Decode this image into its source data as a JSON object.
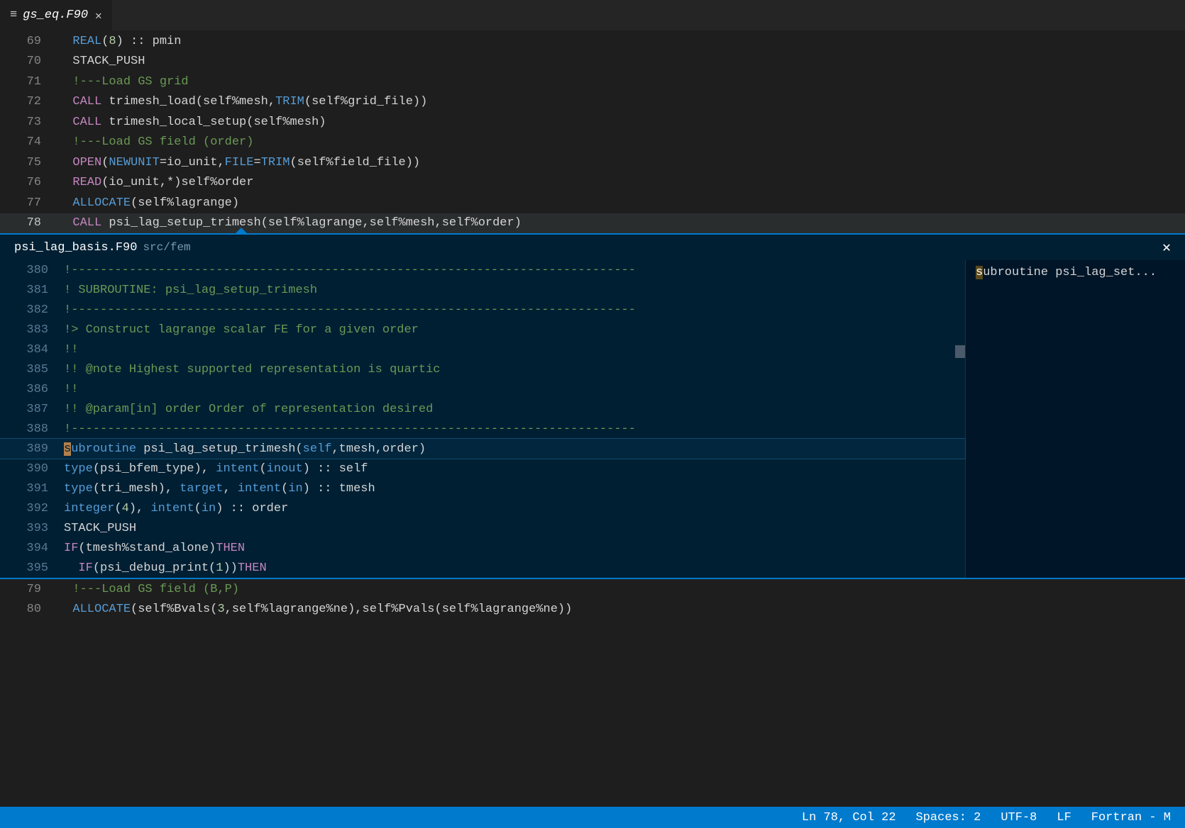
{
  "tab": {
    "filename": "gs_eq.F90",
    "close_glyph": "✕",
    "menu_glyph": "≡"
  },
  "main_lines": [
    {
      "n": 69,
      "segments": [
        {
          "t": "  ",
          "c": "c-id"
        },
        {
          "t": "REAL",
          "c": "c-kw"
        },
        {
          "t": "(",
          "c": "c-op"
        },
        {
          "t": "8",
          "c": "c-num"
        },
        {
          "t": ") :: pmin",
          "c": "c-id"
        }
      ]
    },
    {
      "n": 70,
      "segments": [
        {
          "t": "  STACK_PUSH",
          "c": "c-id"
        }
      ]
    },
    {
      "n": 71,
      "segments": [
        {
          "t": "  !---Load GS grid",
          "c": "c-cmt"
        }
      ]
    },
    {
      "n": 72,
      "segments": [
        {
          "t": "  ",
          "c": "c-id"
        },
        {
          "t": "CALL",
          "c": "c-call"
        },
        {
          "t": " trimesh_load(self%mesh,",
          "c": "c-id"
        },
        {
          "t": "TRIM",
          "c": "c-kw"
        },
        {
          "t": "(self%grid_file))",
          "c": "c-id"
        }
      ]
    },
    {
      "n": 73,
      "segments": [
        {
          "t": "  ",
          "c": "c-id"
        },
        {
          "t": "CALL",
          "c": "c-call"
        },
        {
          "t": " trimesh_local_setup(self%mesh)",
          "c": "c-id"
        }
      ]
    },
    {
      "n": 74,
      "segments": [
        {
          "t": "  !---Load GS field (order)",
          "c": "c-cmt"
        }
      ]
    },
    {
      "n": 75,
      "segments": [
        {
          "t": "  ",
          "c": "c-id"
        },
        {
          "t": "OPEN",
          "c": "c-call"
        },
        {
          "t": "(",
          "c": "c-id"
        },
        {
          "t": "NEWUNIT",
          "c": "c-kw"
        },
        {
          "t": "=io_unit,",
          "c": "c-id"
        },
        {
          "t": "FILE",
          "c": "c-kw"
        },
        {
          "t": "=",
          "c": "c-id"
        },
        {
          "t": "TRIM",
          "c": "c-kw"
        },
        {
          "t": "(self%field_file))",
          "c": "c-id"
        }
      ]
    },
    {
      "n": 76,
      "segments": [
        {
          "t": "  ",
          "c": "c-id"
        },
        {
          "t": "READ",
          "c": "c-call"
        },
        {
          "t": "(io_unit,*)self%order",
          "c": "c-id"
        }
      ]
    },
    {
      "n": 77,
      "segments": [
        {
          "t": "  ",
          "c": "c-id"
        },
        {
          "t": "ALLOCATE",
          "c": "c-kw"
        },
        {
          "t": "(self%lagrange)",
          "c": "c-id"
        }
      ]
    },
    {
      "n": 78,
      "hl": true,
      "segments": [
        {
          "t": "  ",
          "c": "c-id"
        },
        {
          "t": "CALL",
          "c": "c-call"
        },
        {
          "t": " psi_lag_setup_trimesh(self%lagrange,self%mesh,self%order)",
          "c": "c-id"
        }
      ]
    }
  ],
  "main_lines_after": [
    {
      "n": 79,
      "segments": [
        {
          "t": "  !---Load GS field (B,P)",
          "c": "c-cmt"
        }
      ]
    },
    {
      "n": 80,
      "segments": [
        {
          "t": "  ",
          "c": "c-id"
        },
        {
          "t": "ALLOCATE",
          "c": "c-kw"
        },
        {
          "t": "(self%Bvals(",
          "c": "c-id"
        },
        {
          "t": "3",
          "c": "c-num"
        },
        {
          "t": ",self%lagrange%ne),self%Pvals(self%lagrange%ne))",
          "c": "c-id"
        }
      ]
    }
  ],
  "peek": {
    "filename": "psi_lag_basis.F90",
    "path": "src/fem",
    "close_glyph": "✕",
    "sidebar_item_prefix": "s",
    "sidebar_item_rest": "ubroutine psi_lag_set...",
    "lines": [
      {
        "n": 380,
        "segments": [
          {
            "t": "!------------------------------------------------------------------------------",
            "c": "c-cmt"
          }
        ]
      },
      {
        "n": 381,
        "segments": [
          {
            "t": "! SUBROUTINE: psi_lag_setup_trimesh",
            "c": "c-cmt"
          }
        ]
      },
      {
        "n": 382,
        "segments": [
          {
            "t": "!------------------------------------------------------------------------------",
            "c": "c-cmt"
          }
        ]
      },
      {
        "n": 383,
        "segments": [
          {
            "t": "!> Construct lagrange scalar FE for a given order",
            "c": "c-cmt"
          }
        ]
      },
      {
        "n": 384,
        "segments": [
          {
            "t": "!!",
            "c": "c-cmt"
          }
        ]
      },
      {
        "n": 385,
        "segments": [
          {
            "t": "!! @note Highest supported representation is quartic",
            "c": "c-cmt"
          }
        ]
      },
      {
        "n": 386,
        "segments": [
          {
            "t": "!!",
            "c": "c-cmt"
          }
        ]
      },
      {
        "n": 387,
        "segments": [
          {
            "t": "!! @param[in] order Order of representation desired",
            "c": "c-cmt"
          }
        ]
      },
      {
        "n": 388,
        "segments": [
          {
            "t": "!------------------------------------------------------------------------------",
            "c": "c-cmt"
          }
        ]
      },
      {
        "n": 389,
        "hl": true,
        "segments": [
          {
            "t": "s",
            "c": "cursor-mark"
          },
          {
            "t": "ubroutine",
            "c": "c-kw"
          },
          {
            "t": " psi_lag_setup_trimesh(",
            "c": "c-id"
          },
          {
            "t": "self",
            "c": "c-kw"
          },
          {
            "t": ",tmesh,order)",
            "c": "c-id"
          }
        ]
      },
      {
        "n": 390,
        "segments": [
          {
            "t": "type",
            "c": "c-kw"
          },
          {
            "t": "(psi_bfem_type), ",
            "c": "c-id"
          },
          {
            "t": "intent",
            "c": "c-kw"
          },
          {
            "t": "(",
            "c": "c-id"
          },
          {
            "t": "inout",
            "c": "c-kw"
          },
          {
            "t": ") :: self",
            "c": "c-id"
          }
        ]
      },
      {
        "n": 391,
        "segments": [
          {
            "t": "type",
            "c": "c-kw"
          },
          {
            "t": "(tri_mesh), ",
            "c": "c-id"
          },
          {
            "t": "target",
            "c": "c-kw"
          },
          {
            "t": ", ",
            "c": "c-id"
          },
          {
            "t": "intent",
            "c": "c-kw"
          },
          {
            "t": "(",
            "c": "c-id"
          },
          {
            "t": "in",
            "c": "c-kw"
          },
          {
            "t": ") :: tmesh",
            "c": "c-id"
          }
        ]
      },
      {
        "n": 392,
        "segments": [
          {
            "t": "integer",
            "c": "c-kw"
          },
          {
            "t": "(",
            "c": "c-id"
          },
          {
            "t": "4",
            "c": "c-num"
          },
          {
            "t": "), ",
            "c": "c-id"
          },
          {
            "t": "intent",
            "c": "c-kw"
          },
          {
            "t": "(",
            "c": "c-id"
          },
          {
            "t": "in",
            "c": "c-kw"
          },
          {
            "t": ") :: order",
            "c": "c-id"
          }
        ]
      },
      {
        "n": 393,
        "segments": [
          {
            "t": "STACK_PUSH",
            "c": "c-id"
          }
        ]
      },
      {
        "n": 394,
        "segments": [
          {
            "t": "IF",
            "c": "c-call"
          },
          {
            "t": "(tmesh%stand_alone)",
            "c": "c-id"
          },
          {
            "t": "THEN",
            "c": "c-call"
          }
        ]
      },
      {
        "n": 395,
        "segments": [
          {
            "t": "  ",
            "c": "c-id"
          },
          {
            "t": "IF",
            "c": "c-call"
          },
          {
            "t": "(psi_debug_print(",
            "c": "c-id"
          },
          {
            "t": "1",
            "c": "c-num"
          },
          {
            "t": "))",
            "c": "c-id"
          },
          {
            "t": "THEN",
            "c": "c-call"
          }
        ]
      }
    ]
  },
  "status": {
    "position": "Ln 78, Col 22",
    "spaces": "Spaces: 2",
    "encoding": "UTF-8",
    "eol": "LF",
    "lang": "Fortran - M"
  }
}
